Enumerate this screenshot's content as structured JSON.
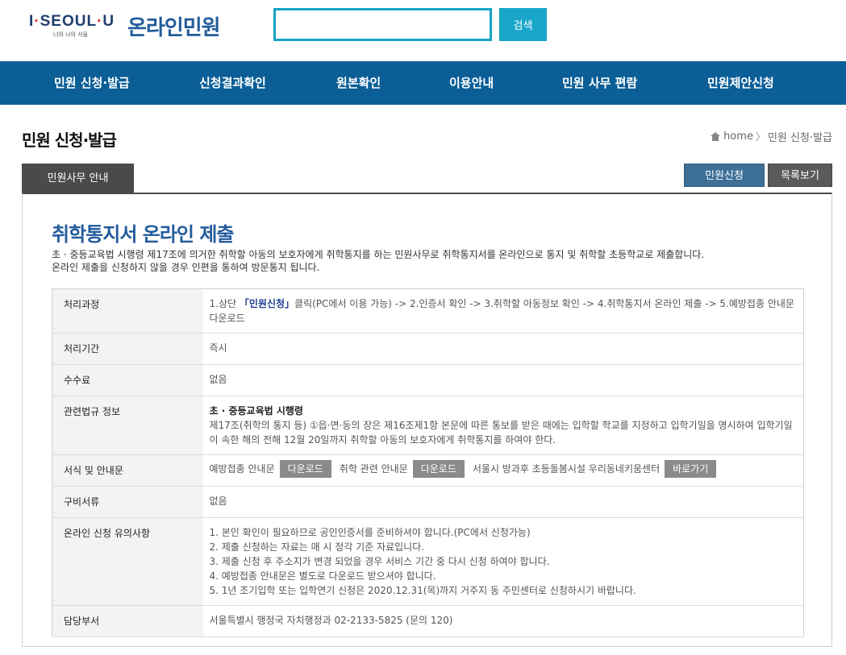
{
  "header": {
    "logo_brand_part1": "I",
    "logo_brand_dot1": "·",
    "logo_brand_part2": "SEOUL",
    "logo_brand_dot2": "·",
    "logo_brand_part3": "U",
    "logo_tagline": "너와 나의 서울",
    "site_title": "온라인민원",
    "search_placeholder": "",
    "search_button": "검색"
  },
  "nav": {
    "items": [
      {
        "label": "민원 신청·발급"
      },
      {
        "label": "신청결과확인"
      },
      {
        "label": "원본확인"
      },
      {
        "label": "이용안내"
      },
      {
        "label": "민원 사무 편람"
      },
      {
        "label": "민원제안신청"
      }
    ]
  },
  "page": {
    "title": "민원 신청·발급",
    "breadcrumb_home": "home",
    "breadcrumb_current": "민원 신청·발급",
    "tab_label": "민원사무 안내",
    "apply_button": "민원신청",
    "list_button": "목록보기"
  },
  "doc": {
    "title": "취학통지서 온라인 제출",
    "desc_line1": "초 · 중등교육법 시행령 제17조에 의거한 취학할 아동의 보호자에게 취학통지를 하는 민원사무로 취학통지서를 온라인으로 통지 및 취학할 초등학교로 제출합니다.",
    "desc_line2": "온라인 제출을 신청하지 않을 경우 인편을 통하여 방문통지 됩니다."
  },
  "table": {
    "process_label": "처리과정",
    "process_prefix": "1.상단 ",
    "process_link": "「민원신청」",
    "process_suffix": "클릭(PC에서 이용 가능) -> 2.인증서 확인 -> 3.취학할 아동정보 확인 -> 4.취학통지서 온라인 제출 -> 5.예방접종 안내문 다운로드",
    "period_label": "처리기간",
    "period_value": "즉시",
    "fee_label": "수수료",
    "fee_value": "없음",
    "law_label": "관련법규 정보",
    "law_title": "초 · 중등교육법 시행령",
    "law_text": "제17조(취학의 통지 등) ①읍·면·동의 장은 제16조제1항 본문에 따른 통보를 받은 때에는 입학할 학교를 지정하고 입학기일을 명시하여 입학기일이 속한 해의 전해 12월 20일까지 취학할 아동의 보호자에게 취학통지를 하여야 한다.",
    "forms_label": "서식 및 안내문",
    "form1_label": "예방접종 안내문",
    "form1_button": "다운로드",
    "form2_label": "취학 관련 안내문",
    "form2_button": "다운로드",
    "form3_label": "서울시 방과후 초등돌봄시설 우리동네키움센터",
    "form3_button": "바로가기",
    "docs_label": "구비서류",
    "docs_value": "없음",
    "notes_label": "온라인 신청 유의사항",
    "notes": [
      "1. 본인 확인이 필요하므로 공인인증서를 준비하셔야 합니다.(PC에서 신청가능)",
      "2. 제출 신청하는 자료는 매 시 정각 기준 자료입니다.",
      "3. 제출 신청 후 주소지가 변경 되었을 경우 서비스 기간 중 다시 신청 하여야 합니다.",
      "4. 예방접종 안내문은 별도로 다운로드 받으셔야 합니다.",
      "5. 1년 조기입학 또는 입학연기 신청은 2020.12.31(목)까지 거주지 동 주민센터로 신청하시기 바랍니다."
    ],
    "dept_label": "담당부서",
    "dept_value": "서울특별시 행정국 자치행정과 02-2133-5825 (문의 120)"
  },
  "colors": {
    "nav_bg": "#0b5e96",
    "search_accent": "#1aa6c9",
    "title_blue": "#245c9c"
  },
  "icons": [
    "home-icon",
    "chevron-right-icon"
  ]
}
